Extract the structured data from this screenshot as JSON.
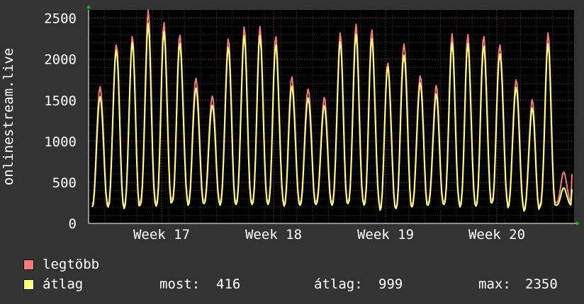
{
  "chart_data": {
    "type": "line",
    "ylabel": "onlinestream.live",
    "ylim": [
      0,
      2600
    ],
    "yticks": [
      0,
      500,
      1000,
      1500,
      2000,
      2500
    ],
    "xticks": [
      "Week 17",
      "Week 18",
      "Week 19",
      "Week 20"
    ],
    "grid": true,
    "cycles": 30,
    "series": [
      {
        "name": "legtöbb",
        "color": "#f47c7c",
        "peaks": [
          1750,
          2250,
          2250,
          2480,
          2350,
          2300,
          1850,
          1620,
          2250,
          2300,
          2290,
          2250,
          1850,
          1720,
          1560,
          2250,
          2310,
          2300,
          2000,
          2300,
          1850,
          1650,
          2200,
          2220,
          2300,
          2280,
          1820,
          1500,
          2220,
          600
        ],
        "troughs": [
          230,
          200,
          260,
          240,
          300,
          250,
          270,
          250,
          260,
          260,
          260,
          240,
          250,
          260,
          250,
          270,
          250,
          180,
          200,
          230,
          250,
          260,
          230,
          240,
          280,
          220,
          170,
          230,
          250
        ]
      },
      {
        "name": "átlag",
        "color": "#ffff80",
        "peaks": [
          1620,
          2180,
          2180,
          2330,
          2250,
          2200,
          1720,
          1500,
          2150,
          2200,
          2190,
          2150,
          1730,
          1600,
          1460,
          2150,
          2200,
          2200,
          1950,
          2150,
          1760,
          1550,
          2100,
          2120,
          2180,
          2160,
          1720,
          1400,
          2100,
          416
        ],
        "troughs": [
          200,
          180,
          220,
          210,
          260,
          220,
          240,
          220,
          230,
          230,
          230,
          210,
          220,
          230,
          220,
          240,
          220,
          160,
          180,
          200,
          220,
          230,
          200,
          210,
          250,
          190,
          150,
          200,
          220
        ]
      }
    ],
    "stats": {
      "most_label": "most:",
      "most": "416",
      "atlag_label": "átlag:",
      "atlag": "999",
      "max_label": "max:",
      "max": "2350"
    }
  }
}
